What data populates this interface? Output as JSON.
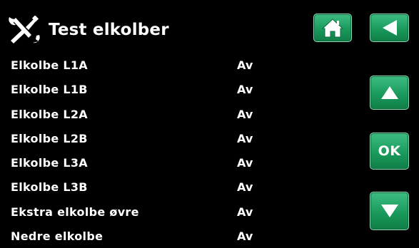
{
  "header": {
    "title": "Test elkolber",
    "icon": "tools-icon"
  },
  "nav": {
    "home_icon": "home-icon",
    "back_icon": "back-arrow-icon",
    "up_icon": "up-arrow-icon",
    "ok_label": "OK",
    "down_icon": "down-arrow-icon"
  },
  "rows": [
    {
      "label": "Elkolbe  L1A",
      "value": "Av"
    },
    {
      "label": "Elkolbe  L1B",
      "value": "Av"
    },
    {
      "label": "Elkolbe  L2A",
      "value": "Av"
    },
    {
      "label": "Elkolbe  L2B",
      "value": "Av"
    },
    {
      "label": "Elkolbe  L3A",
      "value": "Av"
    },
    {
      "label": "Elkolbe  L3B",
      "value": "Av"
    },
    {
      "label": "Ekstra elkolbe øvre",
      "value": "Av"
    },
    {
      "label": "Nedre elkolbe",
      "value": "Av"
    }
  ],
  "colors": {
    "background": "#000000",
    "text": "#ffffff",
    "button_green": "#1a9a5c"
  }
}
